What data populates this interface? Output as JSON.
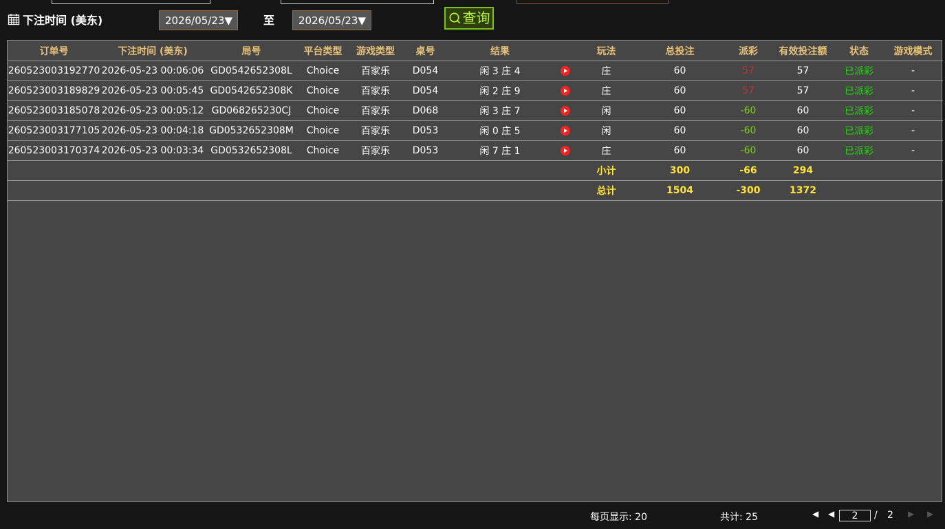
{
  "filter": {
    "label": "下注时间 (美东)",
    "start_date": "2026/05/23▼",
    "to_label": "至",
    "end_date": "2026/05/23▼",
    "query_label": "查询"
  },
  "table": {
    "columns": [
      "订单号",
      "下注时间 (美东)",
      "局号",
      "平台类型",
      "游戏类型",
      "桌号",
      "结果",
      "",
      "玩法",
      "总投注",
      "派彩",
      "有效投注额",
      "状态",
      "游戏模式"
    ],
    "rows": [
      {
        "order": "260523003192770",
        "time": "2026-05-23 00:06:06",
        "round": "GD0542652308L",
        "platform": "Choice",
        "game": "百家乐",
        "table_no": "D054",
        "result": "闲 3 庄 4",
        "play": "庄",
        "bet": "60",
        "payout": "57",
        "valid_bet": "57",
        "status": "已派彩",
        "mode": "-"
      },
      {
        "order": "260523003189829",
        "time": "2026-05-23 00:05:45",
        "round": "GD0542652308K",
        "platform": "Choice",
        "game": "百家乐",
        "table_no": "D054",
        "result": "闲 2 庄 9",
        "play": "庄",
        "bet": "60",
        "payout": "57",
        "valid_bet": "57",
        "status": "已派彩",
        "mode": "-"
      },
      {
        "order": "260523003185078",
        "time": "2026-05-23 00:05:12",
        "round": "GD068265230CJ",
        "platform": "Choice",
        "game": "百家乐",
        "table_no": "D068",
        "result": "闲 3 庄 7",
        "play": "闲",
        "bet": "60",
        "payout": "-60",
        "valid_bet": "60",
        "status": "已派彩",
        "mode": "-"
      },
      {
        "order": "260523003177105",
        "time": "2026-05-23 00:04:18",
        "round": "GD0532652308M",
        "platform": "Choice",
        "game": "百家乐",
        "table_no": "D053",
        "result": "闲 0 庄 5",
        "play": "闲",
        "bet": "60",
        "payout": "-60",
        "valid_bet": "60",
        "status": "已派彩",
        "mode": "-"
      },
      {
        "order": "260523003170374",
        "time": "2026-05-23 00:03:34",
        "round": "GD0532652308L",
        "platform": "Choice",
        "game": "百家乐",
        "table_no": "D053",
        "result": "闲 7 庄 1",
        "play": "庄",
        "bet": "60",
        "payout": "-60",
        "valid_bet": "60",
        "status": "已派彩",
        "mode": "-"
      }
    ],
    "subtotal": {
      "label": "小计",
      "bet": "300",
      "payout": "-66",
      "valid_bet": "294"
    },
    "total": {
      "label": "总计",
      "bet": "1504",
      "payout": "-300",
      "valid_bet": "1372"
    }
  },
  "footer": {
    "per_page": "每页显示: 20",
    "total_count": "共计: 25",
    "current_page": "2",
    "separator": "/",
    "total_pages": "2"
  },
  "colors": {
    "header_gold": "#e7c178",
    "total_yellow": "#ffe23a",
    "payout_positive": "#c8303a",
    "payout_negative": "#7ed01c",
    "status_settled": "#25d80e",
    "query_border": "#7cc21c"
  }
}
